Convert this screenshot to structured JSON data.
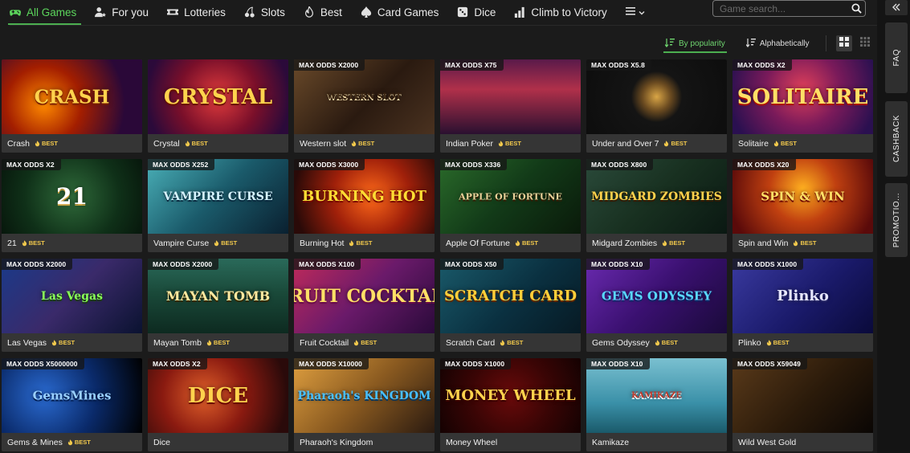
{
  "nav": {
    "items": [
      {
        "label": "All Games",
        "icon": "gamepad-icon",
        "active": true
      },
      {
        "label": "For you",
        "icon": "user-star-icon",
        "active": false
      },
      {
        "label": "Lotteries",
        "icon": "ticket-icon",
        "active": false
      },
      {
        "label": "Slots",
        "icon": "cherries-icon",
        "active": false
      },
      {
        "label": "Best",
        "icon": "flame-icon",
        "active": false
      },
      {
        "label": "Card Games",
        "icon": "spade-icon",
        "active": false
      },
      {
        "label": "Dice",
        "icon": "dice-icon",
        "active": false
      },
      {
        "label": "Climb to Victory",
        "icon": "bar-chart-icon",
        "active": false
      }
    ],
    "more_icon": "menu-lines-icon"
  },
  "search": {
    "placeholder": "Game search..."
  },
  "sort": {
    "by_popularity": "By popularity",
    "alphabetically": "Alphabetically",
    "active": "by_popularity"
  },
  "view": {
    "active": "grid"
  },
  "badge_label": "BEST",
  "games": [
    {
      "name": "Crash",
      "odds": "",
      "best": true,
      "logo": "CRASH"
    },
    {
      "name": "Crystal",
      "odds": "",
      "best": true,
      "logo": "CRYSTAL"
    },
    {
      "name": "Western slot",
      "odds": "MAX ODDS X2000",
      "best": true,
      "logo": "WESTERN SLOT"
    },
    {
      "name": "Indian Poker",
      "odds": "MAX ODDS X75",
      "best": true,
      "logo": ""
    },
    {
      "name": "Under and Over 7",
      "odds": "MAX ODDS X5.8",
      "best": true,
      "logo": ""
    },
    {
      "name": "Solitaire",
      "odds": "MAX ODDS X2",
      "best": true,
      "logo": "SOLITAIRE"
    },
    {
      "name": "21",
      "odds": "MAX ODDS X2",
      "best": true,
      "logo": "21"
    },
    {
      "name": "Vampire Curse",
      "odds": "MAX ODDS X252",
      "best": true,
      "logo": "VAMPIRE CURSE"
    },
    {
      "name": "Burning Hot",
      "odds": "MAX ODDS X3000",
      "best": true,
      "logo": "BURNING HOT"
    },
    {
      "name": "Apple Of Fortune",
      "odds": "MAX ODDS X336",
      "best": true,
      "logo": "APPLE OF FORTUNE"
    },
    {
      "name": "Midgard Zombies",
      "odds": "MAX ODDS X800",
      "best": true,
      "logo": "MIDGARD ZOMBIES"
    },
    {
      "name": "Spin and Win",
      "odds": "MAX ODDS X20",
      "best": true,
      "logo": "SPIN & WIN"
    },
    {
      "name": "Las Vegas",
      "odds": "MAX ODDS X2000",
      "best": true,
      "logo": "Las Vegas"
    },
    {
      "name": "Mayan Tomb",
      "odds": "MAX ODDS X2000",
      "best": true,
      "logo": "MAYAN TOMB"
    },
    {
      "name": "Fruit Cocktail",
      "odds": "MAX ODDS X100",
      "best": true,
      "logo": "FRUIT COCKTAIL"
    },
    {
      "name": "Scratch Card",
      "odds": "MAX ODDS X50",
      "best": true,
      "logo": "SCRATCH CARD"
    },
    {
      "name": "Gems Odyssey",
      "odds": "MAX ODDS X10",
      "best": true,
      "logo": "GEMS ODYSSEY"
    },
    {
      "name": "Plinko",
      "odds": "MAX ODDS X1000",
      "best": true,
      "logo": "Plinko"
    },
    {
      "name": "Gems & Mines",
      "odds": "MAX ODDS X5000000",
      "best": true,
      "logo": "GemsMines"
    },
    {
      "name": "Dice",
      "odds": "MAX ODDS X2",
      "best": false,
      "logo": "DICE"
    },
    {
      "name": "Pharaoh's Kingdom",
      "odds": "MAX ODDS X10000",
      "best": false,
      "logo": "Pharaoh's KINGDOM"
    },
    {
      "name": "Money Wheel",
      "odds": "MAX ODDS X1000",
      "best": false,
      "logo": "MONEY WHEEL"
    },
    {
      "name": "Kamikaze",
      "odds": "MAX ODDS X10",
      "best": false,
      "logo": "KAMIKAZE"
    },
    {
      "name": "Wild West Gold",
      "odds": "MAX ODDS X59049",
      "best": false,
      "logo": ""
    }
  ],
  "sidebar": {
    "collapse_icon": "double-chevron-left-icon",
    "tabs": [
      "FAQ",
      "CASHBACK",
      "PROMOTIO..."
    ]
  },
  "colors": {
    "accent": "#4caf50",
    "badge": "#f2c94c",
    "background": "#1b1b1b"
  }
}
